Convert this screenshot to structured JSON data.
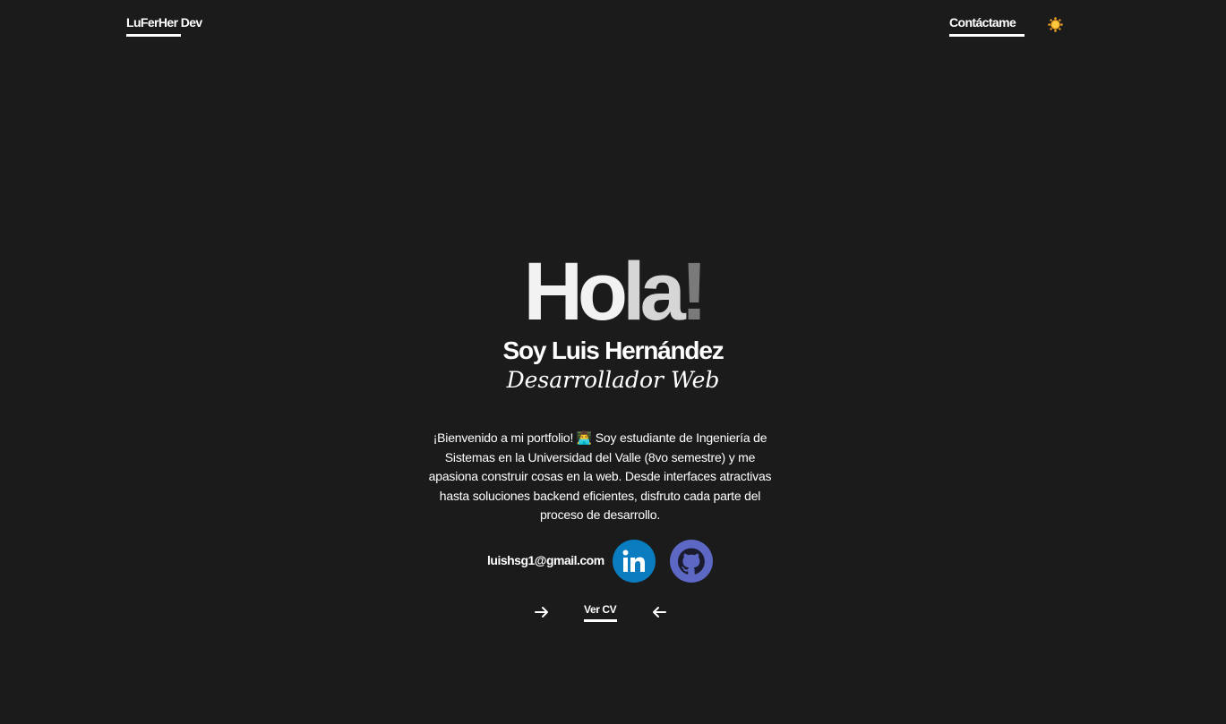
{
  "header": {
    "brand": "LuFerHer Dev",
    "contact_label": "Contáctame",
    "theme_icon": "sun-icon"
  },
  "hero": {
    "hola_part1": "Ho",
    "hola_part2": "la",
    "hola_part3": "!",
    "name": "Soy Luis Hernández",
    "role": "Desarrollador Web",
    "intro": "¡Bienvenido a mi portfolio! 👨‍💻 Soy estudiante de Ingeniería de Sistemas en la Universidad del Valle (8vo semestre) y me apasiona construir cosas en la web. Desde interfaces atractivas hasta soluciones backend eficientes, disfruto cada parte del proceso de desarrollo."
  },
  "contact": {
    "email": "luishsg1@gmail.com",
    "linkedin_icon": "linkedin-icon",
    "github_icon": "github-icon"
  },
  "cv": {
    "label": "Ver CV"
  },
  "colors": {
    "background": "#1b1b1b",
    "linkedin": "#0a7cc0",
    "github": "#5c68c4",
    "sun": "#f5a623"
  }
}
